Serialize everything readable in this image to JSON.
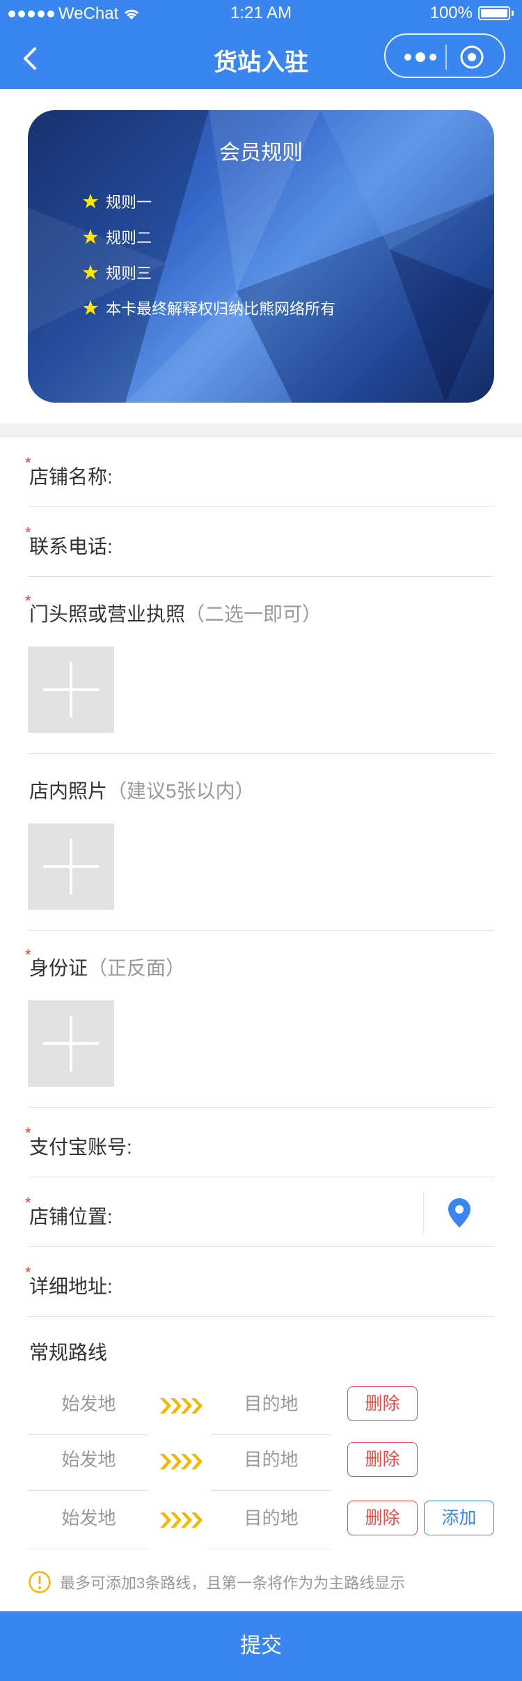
{
  "status_bar": {
    "carrier": "WeChat",
    "time": "1:21 AM",
    "battery": "100%"
  },
  "nav": {
    "title": "货站入驻"
  },
  "card": {
    "title": "会员规则",
    "rules": [
      "规则一",
      "规则二",
      "规则三",
      "本卡最终解释权归纳比熊网络所有"
    ]
  },
  "form": {
    "shop_name": {
      "label": "店铺名称:",
      "required": "*"
    },
    "phone": {
      "label": "联系电话:",
      "required": "*"
    },
    "license": {
      "label": "门头照或营业执照",
      "hint": "（二选一即可）",
      "required": "*"
    },
    "store_photos": {
      "label": "店内照片",
      "hint": "（建议5张以内）"
    },
    "id_card": {
      "label": "身份证",
      "hint": "（正反面）",
      "required": "*"
    },
    "alipay": {
      "label": "支付宝账号:",
      "required": "*"
    },
    "location": {
      "label": "店铺位置:",
      "required": "*"
    },
    "address": {
      "label": "详细地址:",
      "required": "*"
    }
  },
  "routes": {
    "title": "常规路线",
    "items": [
      {
        "from": "始发地",
        "to": "目的地",
        "delete": "删除"
      },
      {
        "from": "始发地",
        "to": "目的地",
        "delete": "删除"
      },
      {
        "from": "始发地",
        "to": "目的地",
        "delete": "删除",
        "add": "添加"
      }
    ],
    "tip": "最多可添加3条路线，且第一条将作为为主路线显示"
  },
  "submit": "提交",
  "colors": {
    "primary": "#3a86f0",
    "danger": "#e84a4a",
    "star": "#ffe600",
    "arrows": "#f5b800"
  }
}
